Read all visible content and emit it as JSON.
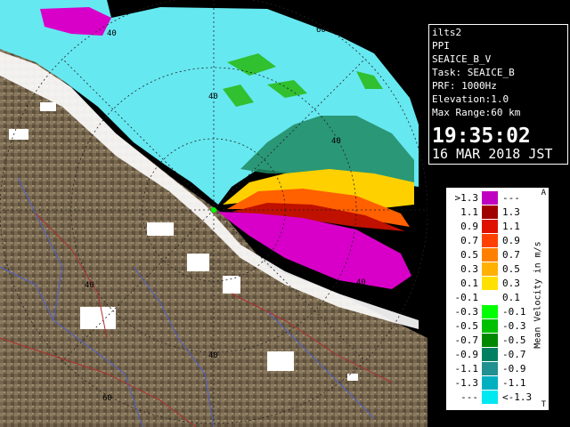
{
  "info": {
    "lines": [
      "ilts2",
      "PPI",
      "SEAICE_B_V",
      "Task: SEAICE_B",
      "PRF: 1000Hz",
      "Elevation:1.0",
      "Max Range:60 km"
    ],
    "time": "19:35:02",
    "date": "16 MAR 2018 JST"
  },
  "legend": {
    "title": "Mean Velocity in m/s",
    "top_mark": "A",
    "bottom_mark": "T",
    "rows": [
      {
        "left": ">1.3",
        "right": "---",
        "color": "#c000c0"
      },
      {
        "left": "1.1",
        "right": "1.3",
        "color": "#a00000"
      },
      {
        "left": "0.9",
        "right": "1.1",
        "color": "#e01000"
      },
      {
        "left": "0.7",
        "right": "0.9",
        "color": "#ff4000"
      },
      {
        "left": "0.5",
        "right": "0.7",
        "color": "#ff8000"
      },
      {
        "left": "0.3",
        "right": "0.5",
        "color": "#ffb000"
      },
      {
        "left": "0.1",
        "right": "0.3",
        "color": "#ffe000"
      },
      {
        "left": "-0.1",
        "right": "0.1",
        "color": "#ffffff"
      },
      {
        "left": "-0.3",
        "right": "-0.1",
        "color": "#00ff00"
      },
      {
        "left": "-0.5",
        "right": "-0.3",
        "color": "#00c000"
      },
      {
        "left": "-0.7",
        "right": "-0.5",
        "color": "#008800"
      },
      {
        "left": "-0.9",
        "right": "-0.7",
        "color": "#008060"
      },
      {
        "left": "-1.1",
        "right": "-0.9",
        "color": "#209090"
      },
      {
        "left": "-1.3",
        "right": "-1.1",
        "color": "#00b0c0"
      },
      {
        "left": "---",
        "right": "<-1.3",
        "color": "#00e8f0"
      }
    ]
  },
  "range_labels": [
    "40",
    "60",
    "40",
    "40",
    "40",
    "40",
    "60",
    "40"
  ],
  "colors": {
    "land": "#7a6a52",
    "sea_ice": "#66e8f0",
    "magenta": "#d800c8",
    "coast_white": "#ffffff",
    "border": "#5060c8",
    "road": "#b03030"
  }
}
